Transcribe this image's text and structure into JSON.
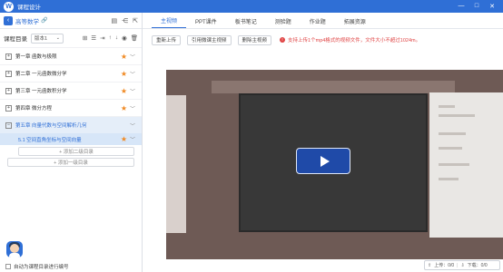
{
  "window": {
    "title": "课程设计",
    "logo_letter": "W",
    "controls": [
      "—",
      "□",
      "✕"
    ]
  },
  "course": {
    "name": "高等数学",
    "link_icon": "🔗"
  },
  "toc": {
    "title": "课程目录",
    "version": "版本1",
    "chapters": [
      {
        "label": "第一章  函数与极限",
        "expander": "+",
        "starred": true
      },
      {
        "label": "第二章  一元函数微分学",
        "expander": "+",
        "starred": true
      },
      {
        "label": "第三章  一元函数积分学",
        "expander": "+",
        "starred": true
      },
      {
        "label": "第四章  微分方程",
        "expander": "+",
        "starred": true
      },
      {
        "label": "第五章  向量代数与空间解析几何",
        "expander": "−",
        "starred": false,
        "active": true
      }
    ],
    "sections": [
      {
        "label": "5.1 空间直角坐标与空间向量",
        "starred": true
      }
    ],
    "add_sub_label": "+ 添加二级目录",
    "add_lvl1_label": "+ 添加一级目录"
  },
  "auto_number_label": "自动为课程目录进行编号",
  "tabs": [
    "主视频",
    "PPT课件",
    "板书笔记",
    "测验题",
    "作业题",
    "拓展资源"
  ],
  "active_tab": 0,
  "actions": {
    "reupload": "重新上传",
    "cite": "引用微课主视频",
    "delete": "删除主视频"
  },
  "notice": "支持上传1个mp4格式的视频文件，文件大小不超过1024m。",
  "status": {
    "upload": "上传：0/0",
    "separator": "|",
    "download": "下载：0/0"
  },
  "colors": {
    "brand": "#2f6fd6",
    "star": "#f08a24",
    "notice": "#e04545"
  }
}
